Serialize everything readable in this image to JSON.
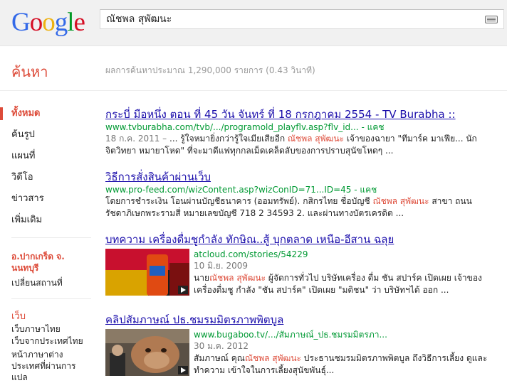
{
  "logo": {
    "letters": [
      "G",
      "o",
      "o",
      "g",
      "l",
      "e"
    ]
  },
  "search": {
    "query": "ณัชพล สุพัฒนะ"
  },
  "header": {
    "section_title": "ค้นหา",
    "stats": "ผลการค้นหาประมาณ 1,290,000 รายการ (0.43 วินาที)"
  },
  "sidebar": {
    "nav": [
      "ทั้งหมด",
      "ค้นรูป",
      "แผนที่",
      "วิดีโอ",
      "ข่าวสาร",
      "เพิ่มเติม"
    ],
    "location_title": "อ.ปากเกร็ด จ. นนทบุรี",
    "location_change": "เปลี่ยนสถานที่",
    "web_title": "เว็บ",
    "web_options": [
      "เว็บภาษาไทย",
      "เว็บจากประเทศไทย",
      "หน้าภาษาต่าง ประเทศที่ผ่านการ แปล"
    ]
  },
  "results": [
    {
      "title": "กระบี่ มือหนึ่ง ตอน ที่ 45 วัน จันทร์ ที่ 18 กรกฎาคม 2554 - TV Burabha ::",
      "url": "www.tvburabha.com/tvb/.../programold_playflv.asp?flv_id...",
      "cache": "- แคช",
      "date": "18 ก.ค. 2011 –",
      "snippet_pre": " ... รู้ใจหมายิ่งกว่ารู้ใจเมียเสียอีก ",
      "snippet_hl": "ณัชพล สุพัฒนะ",
      "snippet_post": " เจ้าของฉายา \"ทีมาร์ค มาเฟีย... นักจิตวิทยา หมายาโหด\" ที่จะมาดีแฟทุกกลเม็ดเคล็ดลับของการปราบสุนัขโหดๆ ..."
    },
    {
      "title": "วิธีการสั่งสินค้าผ่านเว็บ",
      "url": "www.pro-feed.com/wizContent.asp?wizConID=71...ID=45",
      "cache": "- แคช",
      "snippet_pre": "โดยการชำระเงิน โอนผ่านบัญชีธนาคาร (ออมทรัพย์). กสิกรไทย ชื่อบัญชี ",
      "snippet_hl": "ณัชพล สุพัฒนะ",
      "snippet_post": " สาขา ถนนรัชดาภิเษกพระรามสี่ หมายเลขบัญชี 718 2 34593 2. และผ่านทางบัตรเครดิต ..."
    },
    {
      "title": "บทความ เครื่องดื่มชูกำลัง ทักษิณ..สู้ บุกตลาด เหนือ-อีสาน ฉลุย",
      "url": "atcloud.com/stories/54229",
      "date": "10 มิ.ย. 2009",
      "snippet_pre": "นาย",
      "snippet_hl": "ณัชพล สุพัฒนะ",
      "snippet_post": " ผู้จัดการทั่วไป บริษัทเครื่อง ดื่ม ชัน สปาร์ค เปิดเผย เจ้าของเครื่องดื่มชู กำลัง \"ชัน สปาร์ค\" เปิดเผย \"มติชน\" ว่า บริษัทฯได้ ออก ..."
    },
    {
      "title": "คลิปสัมภาษณ์ ปธ.ชมรมมิตรภาพพิตบูล",
      "url": "www.bugaboo.tv/.../สัมภาษณ์_ปธ.ชมรมมิตรภา...",
      "date": "30 ม.ค. 2012",
      "snippet_pre": "สัมภาษณ์ คุณ",
      "snippet_hl": "ณัชพล สุพัฒนะ",
      "snippet_post": " ประธานชมรมมิตรภาพพิตบูล ถึงวิธีการเลี้ยง ดูและทำความ เข้าใจในการเลี้ยงสุนัขพันธุ์..."
    }
  ]
}
